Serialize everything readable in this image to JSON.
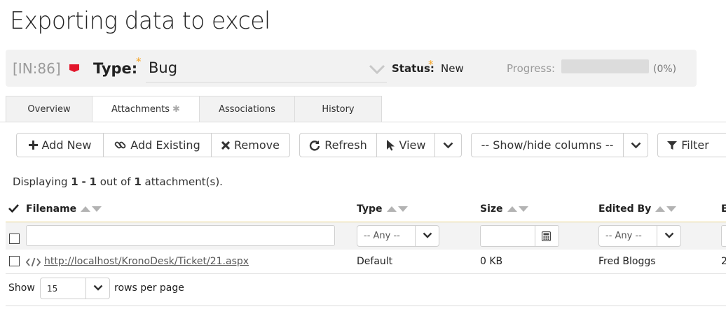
{
  "page": {
    "title": "Exporting data to excel"
  },
  "header": {
    "ticket_id": "[IN:86]",
    "flag_color": "#e2162b",
    "type_label": "Type:",
    "type_value": "Bug",
    "status_label": "Status:",
    "status_value": "New",
    "progress_label": "Progress:",
    "progress_fraction": 0,
    "progress_text": "(0%)",
    "required_star": "*"
  },
  "tabs": [
    {
      "label": "Overview"
    },
    {
      "label": "Attachments",
      "active": true,
      "star": "✱"
    },
    {
      "label": "Associations"
    },
    {
      "label": "History"
    }
  ],
  "toolbar": {
    "add_new": "Add New",
    "add_existing": "Add Existing",
    "remove": "Remove",
    "refresh": "Refresh",
    "view": "View",
    "show_hide_columns": "-- Show/hide columns --",
    "filter": "Filter"
  },
  "display_info": {
    "prefix": "Displaying",
    "from": "1",
    "dash": "-",
    "to": "1",
    "out_of": "out of",
    "total": "1",
    "suffix": "attachment(s)."
  },
  "grid": {
    "columns": [
      "Filename",
      "Type",
      "Size",
      "Edited By",
      "E"
    ],
    "filters": {
      "type_any": "-- Any --",
      "edited_by_any": "-- Any --"
    },
    "rows": [
      {
        "filename": "http://localhost/KronoDesk/Ticket/21.aspx",
        "type": "Default",
        "size": "0 KB",
        "edited_by": "Fred Bloggs",
        "extra": "2"
      }
    ]
  },
  "footer": {
    "show_label": "Show",
    "rows_per_page_value": "15",
    "rows_per_page_label": "rows per page"
  }
}
